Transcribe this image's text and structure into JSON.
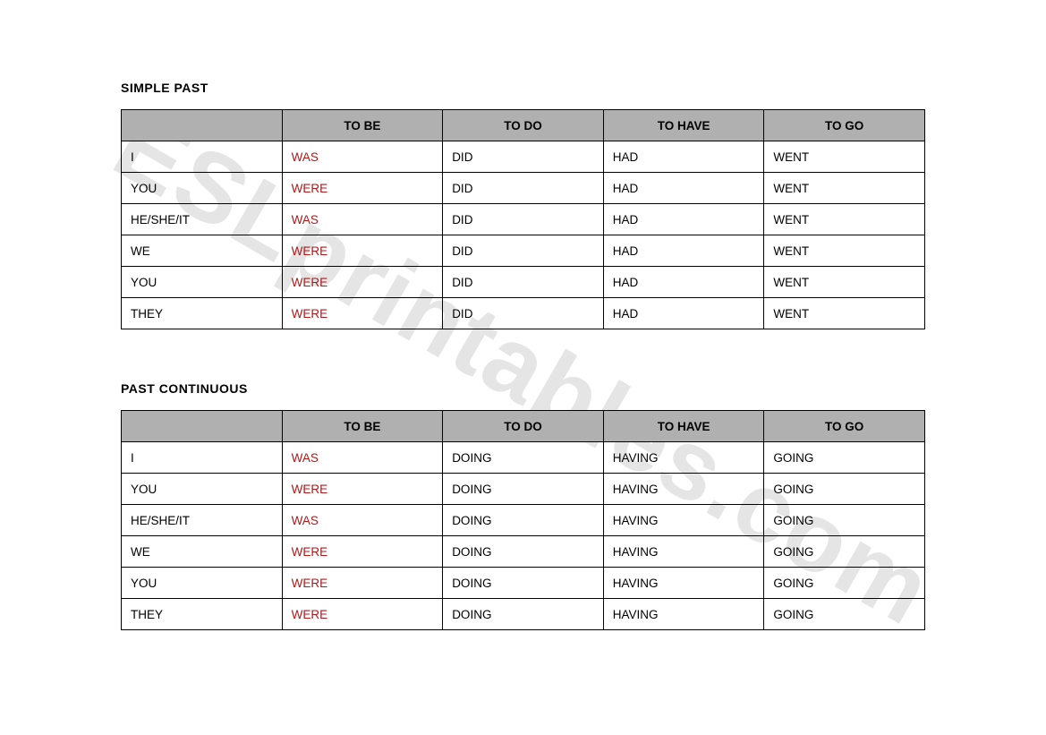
{
  "watermark": "ESLprintables.com",
  "sections": [
    {
      "title": "SIMPLE PAST",
      "headers": [
        "",
        "TO BE",
        "TO DO",
        "TO HAVE",
        "TO GO"
      ],
      "rows": [
        {
          "pronoun": "I",
          "be": "WAS",
          "do": "DID",
          "have": "HAD",
          "go": "WENT"
        },
        {
          "pronoun": "YOU",
          "be": "WERE",
          "do": "DID",
          "have": "HAD",
          "go": "WENT"
        },
        {
          "pronoun": "HE/SHE/IT",
          "be": "WAS",
          "do": "DID",
          "have": "HAD",
          "go": "WENT"
        },
        {
          "pronoun": "WE",
          "be": "WERE",
          "do": "DID",
          "have": "HAD",
          "go": "WENT"
        },
        {
          "pronoun": "YOU",
          "be": "WERE",
          "do": "DID",
          "have": "HAD",
          "go": "WENT"
        },
        {
          "pronoun": "THEY",
          "be": "WERE",
          "do": "DID",
          "have": "HAD",
          "go": "WENT"
        }
      ]
    },
    {
      "title": "PAST CONTINUOUS",
      "headers": [
        "",
        "TO BE",
        "TO DO",
        "TO HAVE",
        "TO GO"
      ],
      "rows": [
        {
          "pronoun": "I",
          "be": "WAS",
          "do": "DOING",
          "have": "HAVING",
          "go": "GOING"
        },
        {
          "pronoun": "YOU",
          "be": "WERE",
          "do": "DOING",
          "have": "HAVING",
          "go": "GOING"
        },
        {
          "pronoun": "HE/SHE/IT",
          "be": "WAS",
          "do": "DOING",
          "have": "HAVING",
          "go": "GOING"
        },
        {
          "pronoun": "WE",
          "be": "WERE",
          "do": "DOING",
          "have": "HAVING",
          "go": "GOING"
        },
        {
          "pronoun": "YOU",
          "be": "WERE",
          "do": "DOING",
          "have": "HAVING",
          "go": "GOING"
        },
        {
          "pronoun": "THEY",
          "be": "WERE",
          "do": "DOING",
          "have": "HAVING",
          "go": "GOING"
        }
      ]
    }
  ]
}
